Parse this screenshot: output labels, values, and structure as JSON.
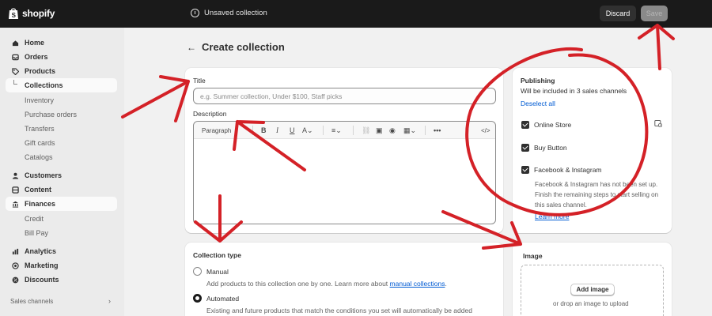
{
  "topbar": {
    "brand": "shopify",
    "status": "Unsaved collection",
    "discard_label": "Discard",
    "save_label": "Save"
  },
  "sidebar": {
    "items": [
      {
        "label": "Home",
        "icon": "home-icon"
      },
      {
        "label": "Orders",
        "icon": "inbox-icon"
      },
      {
        "label": "Products",
        "icon": "tag-icon"
      },
      {
        "label": "Collections"
      },
      {
        "label": "Inventory"
      },
      {
        "label": "Purchase orders"
      },
      {
        "label": "Transfers"
      },
      {
        "label": "Gift cards"
      },
      {
        "label": "Catalogs"
      },
      {
        "label": "Customers",
        "icon": "person-icon"
      },
      {
        "label": "Content",
        "icon": "content-icon"
      },
      {
        "label": "Finances",
        "icon": "bank-icon"
      },
      {
        "label": "Credit"
      },
      {
        "label": "Bill Pay"
      },
      {
        "label": "Analytics",
        "icon": "chart-icon"
      },
      {
        "label": "Marketing",
        "icon": "target-icon"
      },
      {
        "label": "Discounts",
        "icon": "discount-icon"
      }
    ],
    "sales_channels_label": "Sales channels"
  },
  "page": {
    "title": "Create collection"
  },
  "form": {
    "title_label": "Title",
    "title_placeholder": "e.g. Summer collection, Under $100, Staff picks",
    "description_label": "Description",
    "paragraph_select": "Paragraph"
  },
  "collection_type": {
    "title": "Collection type",
    "manual_label": "Manual",
    "manual_desc": "Add products to this collection one by one. Learn more about ",
    "manual_link": "manual collections",
    "manual_desc_end": ".",
    "automated_label": "Automated",
    "automated_desc": "Existing and future products that match the conditions you set will automatically be added"
  },
  "publishing": {
    "title": "Publishing",
    "subtitle": "Will be included in 3 sales channels",
    "deselect_all": "Deselect all",
    "channels": [
      "Online Store",
      "Buy Button",
      "Facebook & Instagram"
    ],
    "facebook_note": "Facebook & Instagram has not been set up. Finish the remaining steps to start selling on this sales channel.",
    "learn_more": "Learn more"
  },
  "image": {
    "title": "Image",
    "add_image": "Add image",
    "drop_text": "or drop an image to upload"
  },
  "colors": {
    "topbar": "#1a1a1a",
    "annotation_red": "#d42127",
    "link": "#005bd3"
  }
}
